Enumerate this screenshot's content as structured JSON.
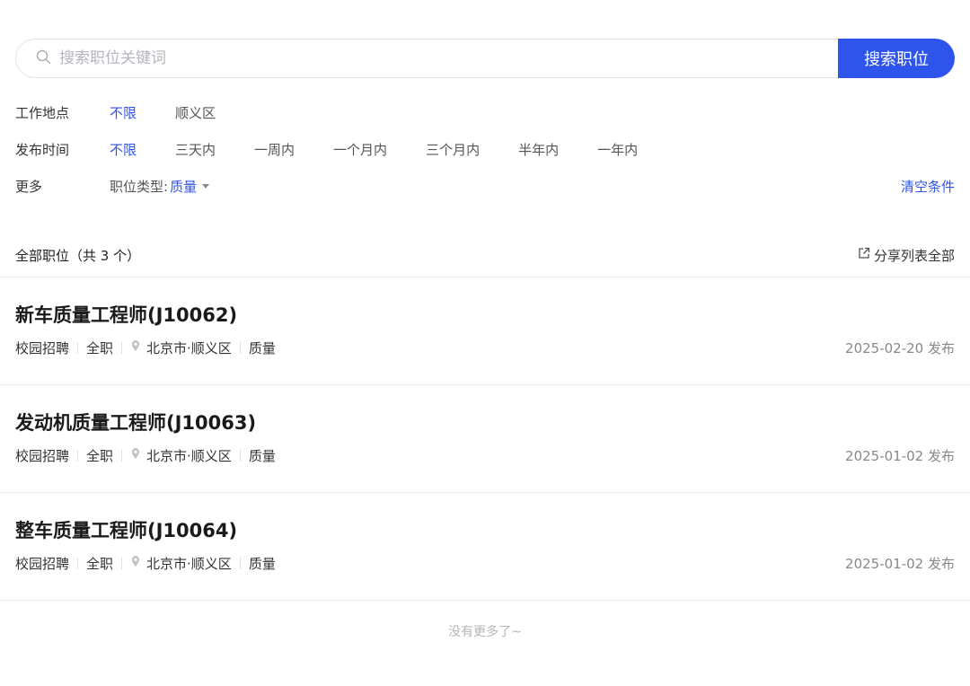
{
  "search": {
    "placeholder": "搜索职位关键词",
    "button_label": "搜索职位"
  },
  "filters": {
    "location": {
      "label": "工作地点",
      "options": [
        "不限",
        "顺义区"
      ],
      "active": "不限"
    },
    "publish_time": {
      "label": "发布时间",
      "options": [
        "不限",
        "三天内",
        "一周内",
        "一个月内",
        "三个月内",
        "半年内",
        "一年内"
      ],
      "active": "不限"
    },
    "more": {
      "label": "更多",
      "type_label": "职位类型:",
      "type_value": "质量",
      "clear_label": "清空条件"
    }
  },
  "list": {
    "header": "全部职位（共 3 个）",
    "share_label": "分享列表全部",
    "jobs": [
      {
        "title": "新车质量工程师(J10062)",
        "recruit_type": "校园招聘",
        "employment": "全职",
        "location": "北京市·顺义区",
        "category": "质量",
        "date": "2025-02-20 发布"
      },
      {
        "title": "发动机质量工程师(J10063)",
        "recruit_type": "校园招聘",
        "employment": "全职",
        "location": "北京市·顺义区",
        "category": "质量",
        "date": "2025-01-02 发布"
      },
      {
        "title": "整车质量工程师(J10064)",
        "recruit_type": "校园招聘",
        "employment": "全职",
        "location": "北京市·顺义区",
        "category": "质量",
        "date": "2025-01-02 发布"
      }
    ],
    "end_text": "没有更多了~"
  },
  "colors": {
    "accent": "#2f54eb",
    "muted": "#888888",
    "divider": "#ececec"
  }
}
